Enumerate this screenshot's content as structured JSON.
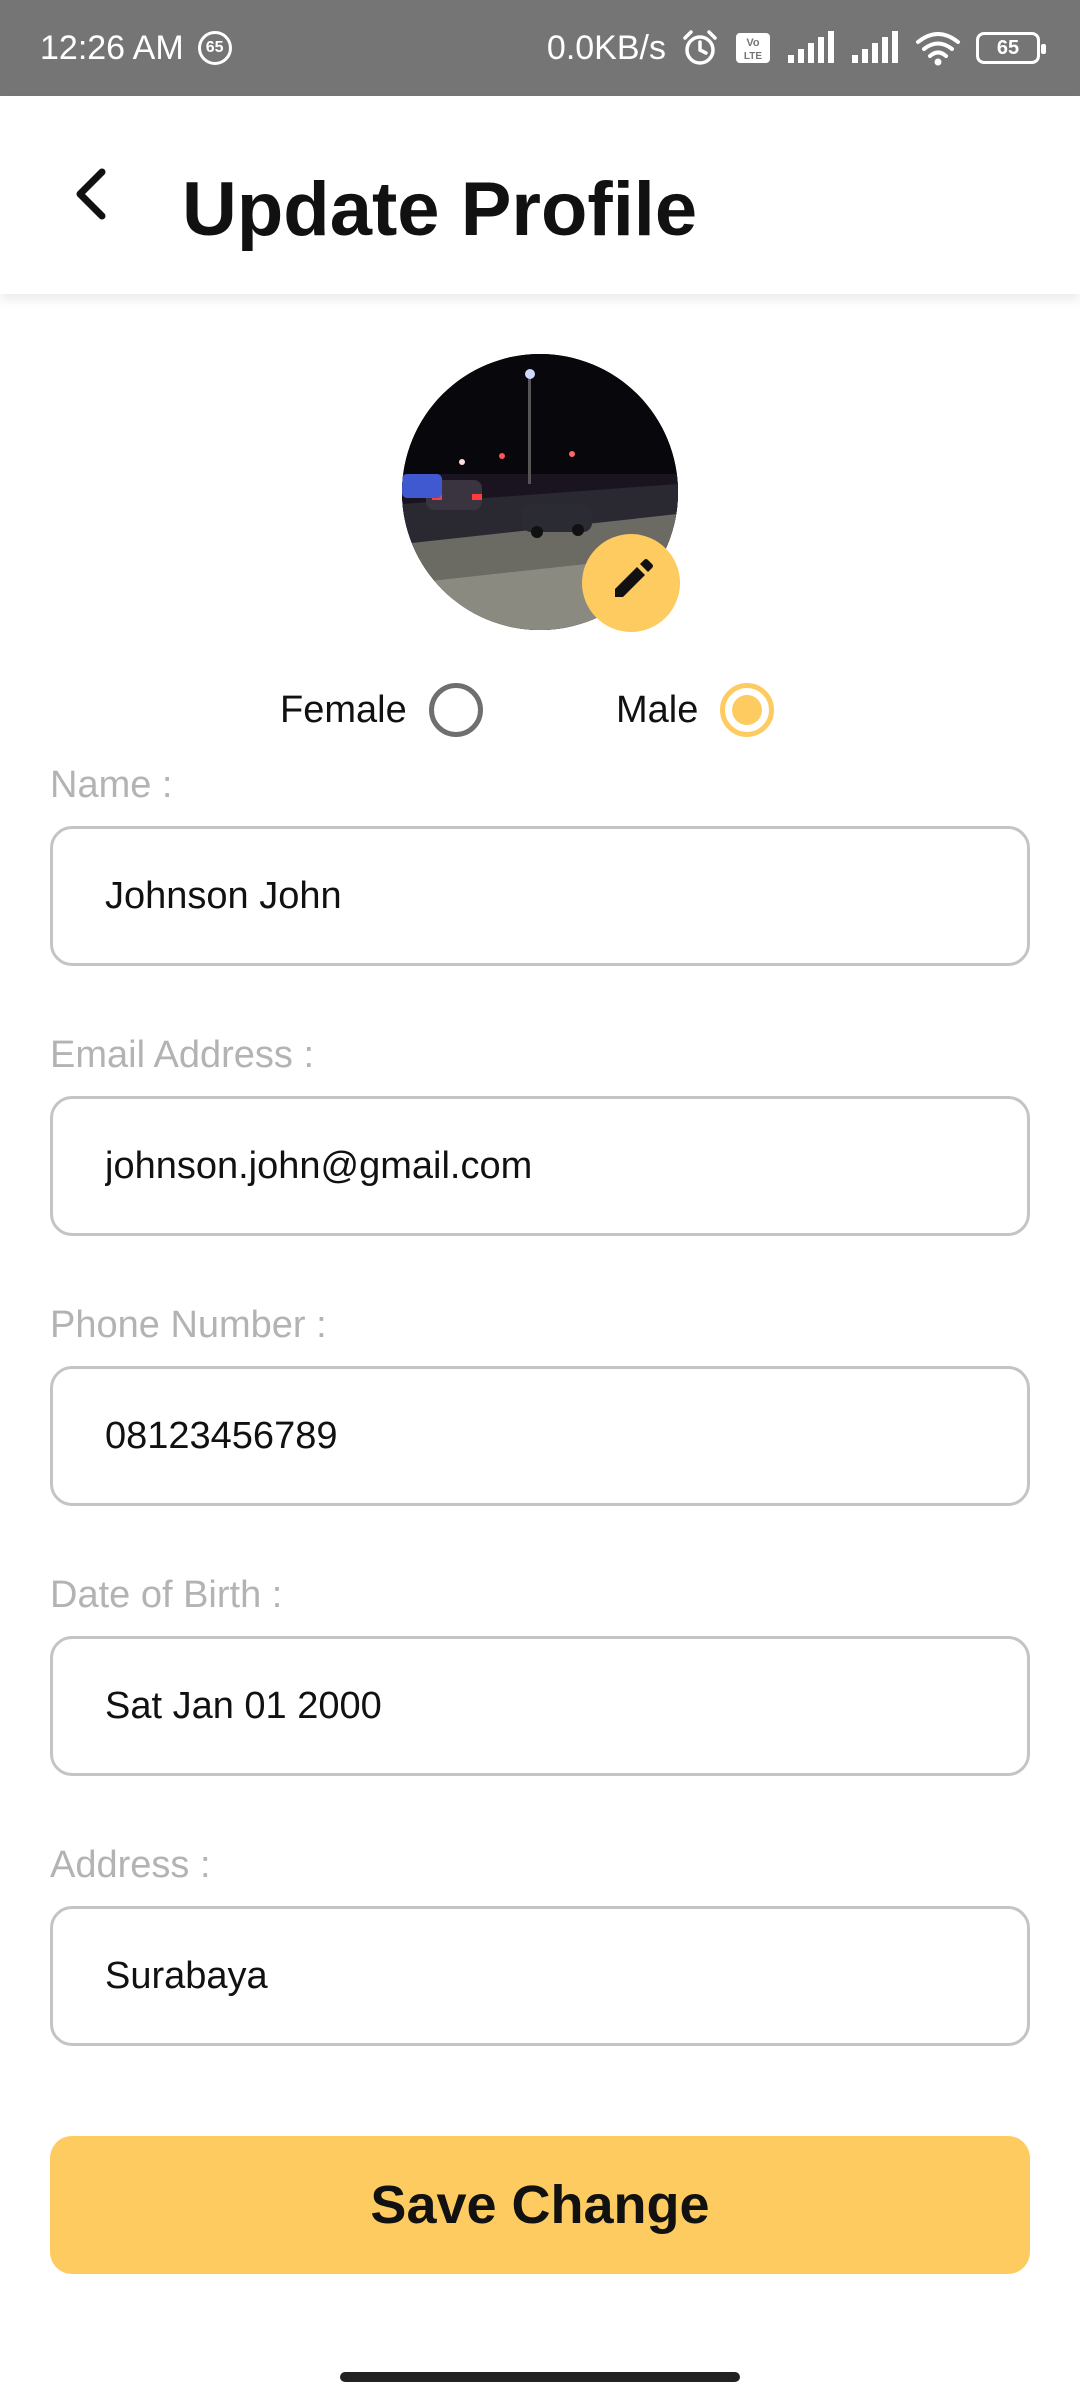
{
  "status_bar": {
    "time": "12:26 AM",
    "notification_badge": "65",
    "network_speed": "0.0KB/s",
    "battery_level": "65",
    "icons": [
      "notification-badge-icon",
      "alarm-icon",
      "volte-icon",
      "signal-icon",
      "signal-icon",
      "wifi-icon",
      "battery-icon"
    ]
  },
  "header": {
    "title": "Update Profile",
    "back_icon": "chevron-left-icon"
  },
  "avatar": {
    "edit_icon": "pencil-icon"
  },
  "gender": {
    "options": [
      {
        "label": "Female",
        "checked": false
      },
      {
        "label": "Male",
        "checked": true
      }
    ]
  },
  "form": {
    "fields": [
      {
        "label": "Name :",
        "value": "Johnson John"
      },
      {
        "label": "Email Address :",
        "value": "johnson.john@gmail.com"
      },
      {
        "label": "Phone Number :",
        "value": "08123456789"
      },
      {
        "label": "Date of Birth :",
        "value": "Sat Jan 01 2000"
      },
      {
        "label": "Address :",
        "value": "Surabaya"
      }
    ]
  },
  "actions": {
    "save_label": "Save Change"
  },
  "colors": {
    "accent": "#FDCB5F",
    "status_bar": "#757575",
    "label_gray": "#B3B3B3",
    "border_gray": "#C4C4C4"
  }
}
